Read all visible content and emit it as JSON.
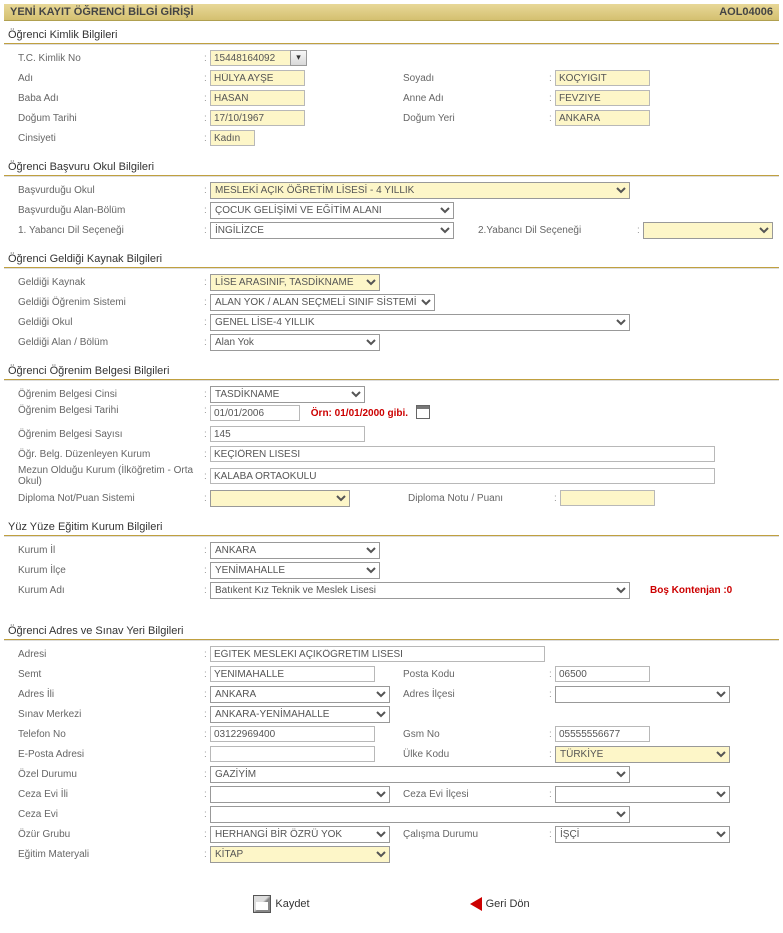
{
  "header": {
    "title": "YENİ KAYIT ÖĞRENCİ  BİLGİ GİRİŞİ",
    "code": "AOL04006"
  },
  "s1": {
    "title": "Öğrenci Kimlik Bilgileri",
    "tc": {
      "label": "T.C. Kimlik No",
      "value": "15448164092"
    },
    "adi": {
      "label": "Adı",
      "value": "HÜLYA AYŞE"
    },
    "soyadi": {
      "label": "Soyadı",
      "value": "KOÇYİĞİT"
    },
    "baba": {
      "label": "Baba Adı",
      "value": "HASAN"
    },
    "anne": {
      "label": "Anne Adı",
      "value": "FEVZİYE"
    },
    "dogumtarihi": {
      "label": "Doğum Tarihi",
      "value": "17/10/1967"
    },
    "dogumyeri": {
      "label": "Doğum Yeri",
      "value": "ANKARA"
    },
    "cinsiyet": {
      "label": "Cinsiyeti",
      "value": "Kadın"
    }
  },
  "s2": {
    "title": "Öğrenci  Başvuru Okul Bilgileri",
    "okul": {
      "label": "Başvurduğu Okul",
      "value": "MESLEKİ AÇIK ÖĞRETİM LİSESİ - 4 YILLIK"
    },
    "bolum": {
      "label": "Başvurduğu Alan-Bölüm",
      "value": "ÇOCUK GELİŞİMİ VE EĞİTİM ALANI"
    },
    "dil1": {
      "label": "1. Yabancı Dil Seçeneği",
      "value": "İNGİLİZCE"
    },
    "dil2": {
      "label": "2.Yabancı Dil Seçeneği",
      "value": ""
    }
  },
  "s3": {
    "title": "Öğrenci Geldiği Kaynak Bilgileri",
    "kaynak": {
      "label": "Geldiği Kaynak",
      "value": "LİSE ARASINIF, TASDİKNAME"
    },
    "sistem": {
      "label": "Geldiği Öğrenim Sistemi",
      "value": "ALAN YOK / ALAN SEÇMELİ SINIF SİSTEMİ"
    },
    "okul": {
      "label": "Geldiği Okul",
      "value": "GENEL LİSE-4 YILLIK"
    },
    "alan": {
      "label": "Geldiği Alan / Bölüm",
      "value": "Alan Yok"
    }
  },
  "s4": {
    "title": "Öğrenci Öğrenim Belgesi Bilgileri",
    "cins": {
      "label": "Öğrenim Belgesi Cinsi",
      "value": "TASDİKNAME"
    },
    "tarih": {
      "label": "Öğrenim Belgesi Tarihi",
      "value": "01/01/2006",
      "hint": "Örn: 01/01/2000 gibi."
    },
    "sayi": {
      "label": "Öğrenim Belgesi Sayısı",
      "value": "145"
    },
    "kurum": {
      "label": "Öğr. Belg. Düzenleyen Kurum",
      "value": "KEÇİÖREN LİSESİ"
    },
    "mezun": {
      "label": "Mezun Olduğu Kurum (İlköğretim - Orta Okul)",
      "value": "KALABA ORTAOKULU"
    },
    "notsis": {
      "label": "Diploma Not/Puan Sistemi",
      "value": ""
    },
    "not": {
      "label": "Diploma Notu / Puanı",
      "value": ""
    }
  },
  "s5": {
    "title": "Yüz Yüze Eğitim Kurum Bilgileri",
    "il": {
      "label": "Kurum İl",
      "value": "ANKARA"
    },
    "ilce": {
      "label": "Kurum İlçe",
      "value": "YENİMAHALLE"
    },
    "adi": {
      "label": "Kurum Adı",
      "value": "Batıkent Kız Teknik ve Meslek Lisesi"
    },
    "kontenjan": "Boş Kontenjan :0"
  },
  "s6": {
    "title": "Öğrenci Adres ve Sınav Yeri Bilgileri",
    "adres": {
      "label": "Adresi",
      "value": "EĞİTEK MESLEKİ AÇIKÖĞRETİM LİSESİ"
    },
    "semt": {
      "label": "Semt",
      "value": "YENİMAHALLE"
    },
    "posta": {
      "label": "Posta Kodu",
      "value": "06500"
    },
    "il": {
      "label": "Adres İli",
      "value": "ANKARA"
    },
    "ilce": {
      "label": "Adres İlçesi",
      "value": ""
    },
    "sinav": {
      "label": "Sınav Merkezi",
      "value": "ANKARA-YENİMAHALLE"
    },
    "tel": {
      "label": "Telefon No",
      "value": "03122969400"
    },
    "gsm": {
      "label": "Gsm No",
      "value": "05555556677"
    },
    "eposta": {
      "label": "E-Posta Adresi",
      "value": ""
    },
    "ulke": {
      "label": "Ülke Kodu",
      "value": "TÜRKİYE"
    },
    "ozel": {
      "label": "Özel Durumu",
      "value": "GAZİYİM"
    },
    "cezail": {
      "label": "Ceza Evi İli",
      "value": ""
    },
    "cezailce": {
      "label": "Ceza Evi İlçesi",
      "value": ""
    },
    "cezaevi": {
      "label": "Ceza Evi",
      "value": ""
    },
    "ozur": {
      "label": "Özür Grubu",
      "value": "HERHANGİ BİR ÖZRÜ YOK"
    },
    "calisma": {
      "label": "Çalışma Durumu",
      "value": "İŞÇİ"
    },
    "materyal": {
      "label": "Eğitim Materyali",
      "value": "KİTAP"
    }
  },
  "buttons": {
    "save": "Kaydet",
    "back": "Geri Dön"
  }
}
